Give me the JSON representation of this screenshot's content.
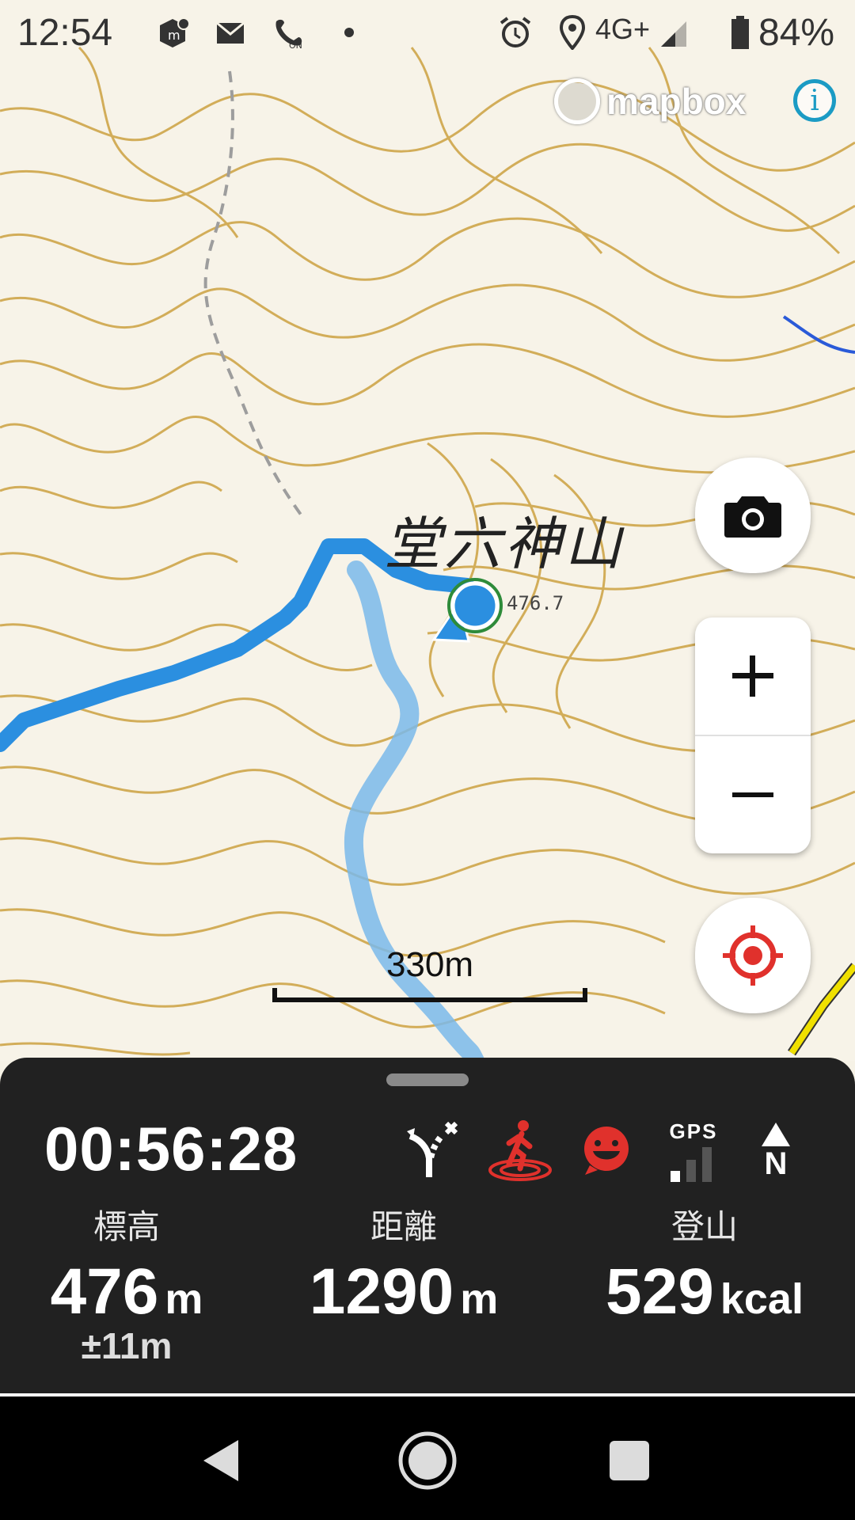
{
  "status_bar": {
    "time": "12:54",
    "network": "4G+",
    "battery": "84%",
    "icons": [
      "app-notification-icon",
      "mail-icon",
      "wifi-calling-on-icon",
      "dot-icon",
      "alarm-icon",
      "location-icon",
      "signal-icon",
      "battery-icon"
    ]
  },
  "map": {
    "attribution": "mapbox",
    "info_symbol": "i",
    "peak_name": "堂六神山",
    "peak_elevation": "476.7",
    "scale_label": "330m",
    "colors": {
      "contour": "#c9a13b",
      "track": "#2b8fe0",
      "planned_route": "#7ab8ea",
      "position": "#2b8fe0",
      "road": "#f0e000"
    }
  },
  "controls": {
    "camera": "camera-icon",
    "zoom_in": "+",
    "zoom_out": "−",
    "locate": "locate-icon"
  },
  "panel": {
    "elapsed_time": "00:56:28",
    "status_icons": [
      "route-off-icon",
      "walking-icon",
      "face-icon",
      "gps-signal-icon",
      "north-compass-icon"
    ],
    "gps_label": "GPS",
    "compass_label": "N",
    "stats": [
      {
        "label": "標高",
        "value": "476",
        "unit": "m",
        "accuracy": "±11m"
      },
      {
        "label": "距離",
        "value": "1290",
        "unit": "m"
      },
      {
        "label": "登山",
        "value": "529",
        "unit": "kcal"
      }
    ],
    "accent_color": "#e0312c"
  },
  "navbar": {
    "buttons": [
      "back-icon",
      "home-icon",
      "recents-icon"
    ]
  }
}
